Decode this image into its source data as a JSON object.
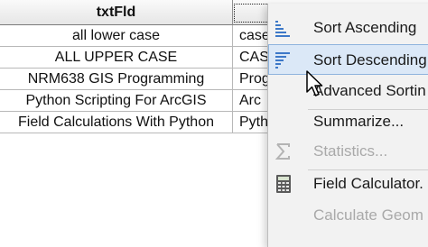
{
  "table": {
    "columns": [
      "txtFld",
      ""
    ],
    "rows": [
      [
        "all lower case",
        "case"
      ],
      [
        "ALL UPPER CASE",
        "CAS"
      ],
      [
        "NRM638 GIS Programming",
        "Prog"
      ],
      [
        "Python Scripting For ArcGIS",
        "Arc"
      ],
      [
        "Field Calculations With Python",
        "Pyth"
      ]
    ]
  },
  "context_menu": {
    "items": [
      {
        "label": "Sort Ascending",
        "icon": "sort-ascending-icon",
        "enabled": true,
        "highlighted": false
      },
      {
        "label": "Sort Descending",
        "icon": "sort-descending-icon",
        "enabled": true,
        "highlighted": true
      },
      {
        "label": "Advanced Sortin",
        "icon": "",
        "enabled": true,
        "highlighted": false
      },
      {
        "label": "Summarize...",
        "icon": "",
        "enabled": true,
        "highlighted": false
      },
      {
        "label": "Statistics...",
        "icon": "sigma-icon",
        "enabled": false,
        "highlighted": false
      },
      {
        "label": "Field Calculator.",
        "icon": "calculator-icon",
        "enabled": true,
        "highlighted": false
      },
      {
        "label": "Calculate Geom",
        "icon": "",
        "enabled": false,
        "highlighted": false
      }
    ]
  },
  "colors": {
    "highlight_bg": "#dbe8f7",
    "highlight_border": "#8fb4dd",
    "menu_bg": "#f2f2f2",
    "disabled_text": "#a9a9a9"
  }
}
